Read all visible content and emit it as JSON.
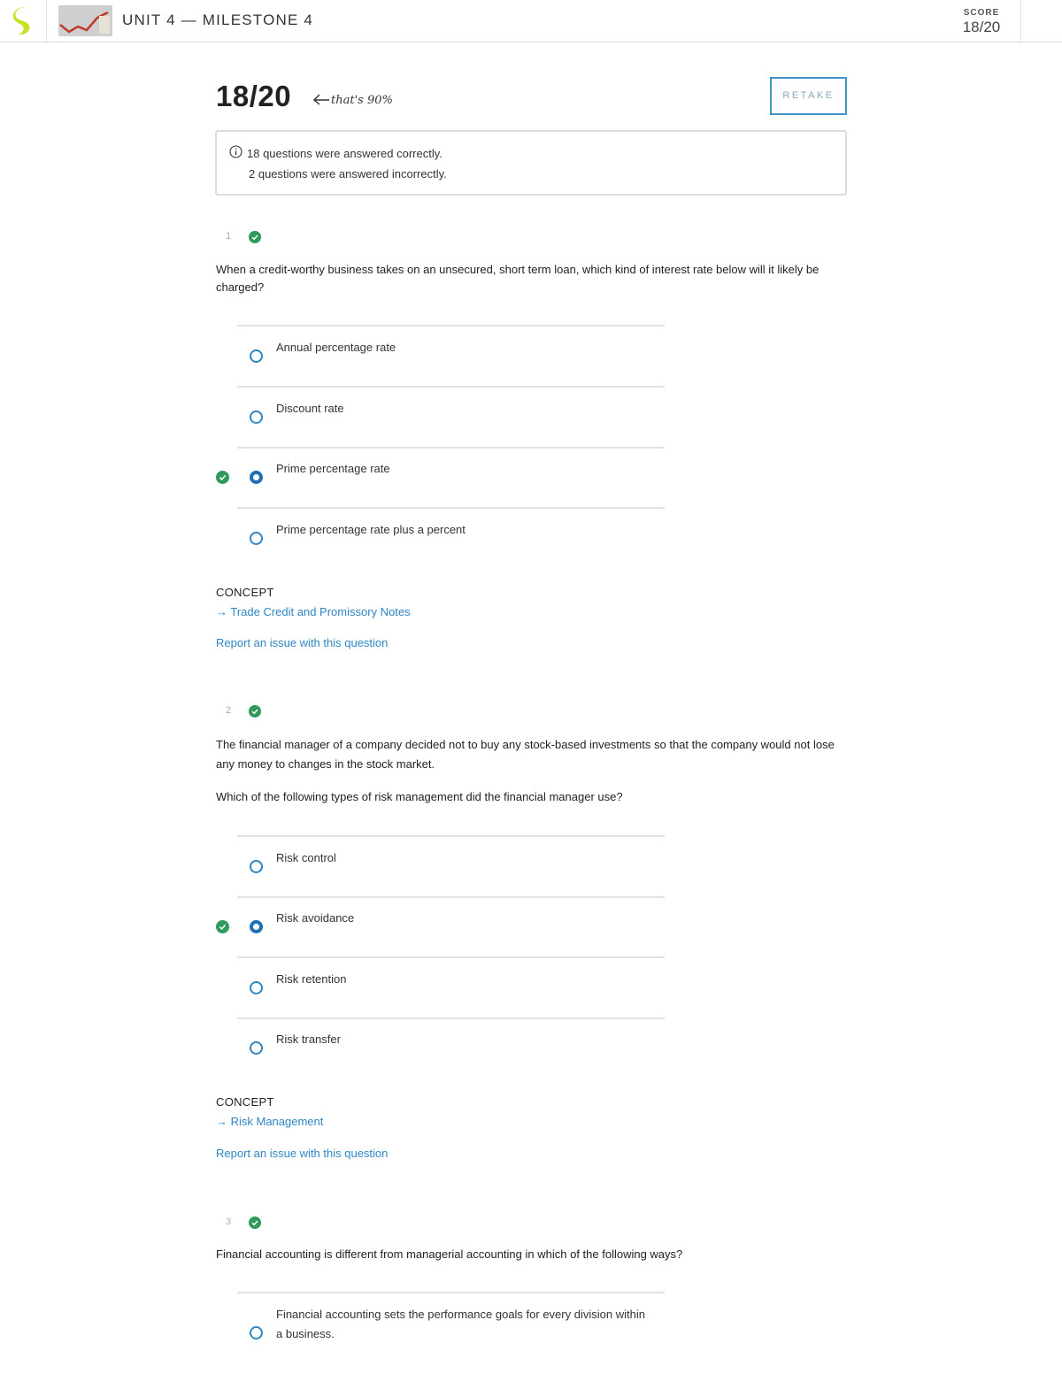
{
  "header": {
    "unit_title": "UNIT 4 — MILESTONE 4",
    "score_label": "SCORE",
    "score_value": "18/20"
  },
  "result": {
    "big_score": "18/20",
    "handwritten_note": "that's 90%",
    "retake_label": "RETAKE",
    "summary_correct": "18 questions were answered correctly.",
    "summary_incorrect": "2 questions were answered incorrectly."
  },
  "colors": {
    "accent_blue": "#2f86c3",
    "correct_green": "#2e9a5c",
    "logo_yellow": "#c8e01e"
  },
  "questions": [
    {
      "number": "1",
      "text": "When a credit-worthy business takes on an unsecured, short term loan, which kind of interest rate below will it likely be charged?",
      "options": [
        {
          "label": "Annual percentage rate",
          "selected": false
        },
        {
          "label": "Discount rate",
          "selected": false
        },
        {
          "label": "Prime percentage rate",
          "selected": true
        },
        {
          "label": "Prime percentage rate plus a percent",
          "selected": false
        }
      ],
      "concept_label": "CONCEPT",
      "concept_link": "→ Trade Credit and Promissory Notes",
      "report_link": "Report an issue with this question"
    },
    {
      "number": "2",
      "text": "The financial manager of a company decided not to buy any stock-based investments so that the company would not lose any money to changes in the stock market.",
      "text2": "Which of the following types of risk management did the financial manager use?",
      "options": [
        {
          "label": "Risk control",
          "selected": false
        },
        {
          "label": "Risk avoidance",
          "selected": true
        },
        {
          "label": "Risk retention",
          "selected": false
        },
        {
          "label": "Risk transfer",
          "selected": false
        }
      ],
      "concept_label": "CONCEPT",
      "concept_link": "→ Risk Management",
      "report_link": "Report an issue with this question"
    },
    {
      "number": "3",
      "text": "Financial accounting is different from managerial accounting in which of the following ways?",
      "options": [
        {
          "label": "Financial accounting sets the performance goals for every division within a business.",
          "selected": false
        }
      ]
    }
  ]
}
